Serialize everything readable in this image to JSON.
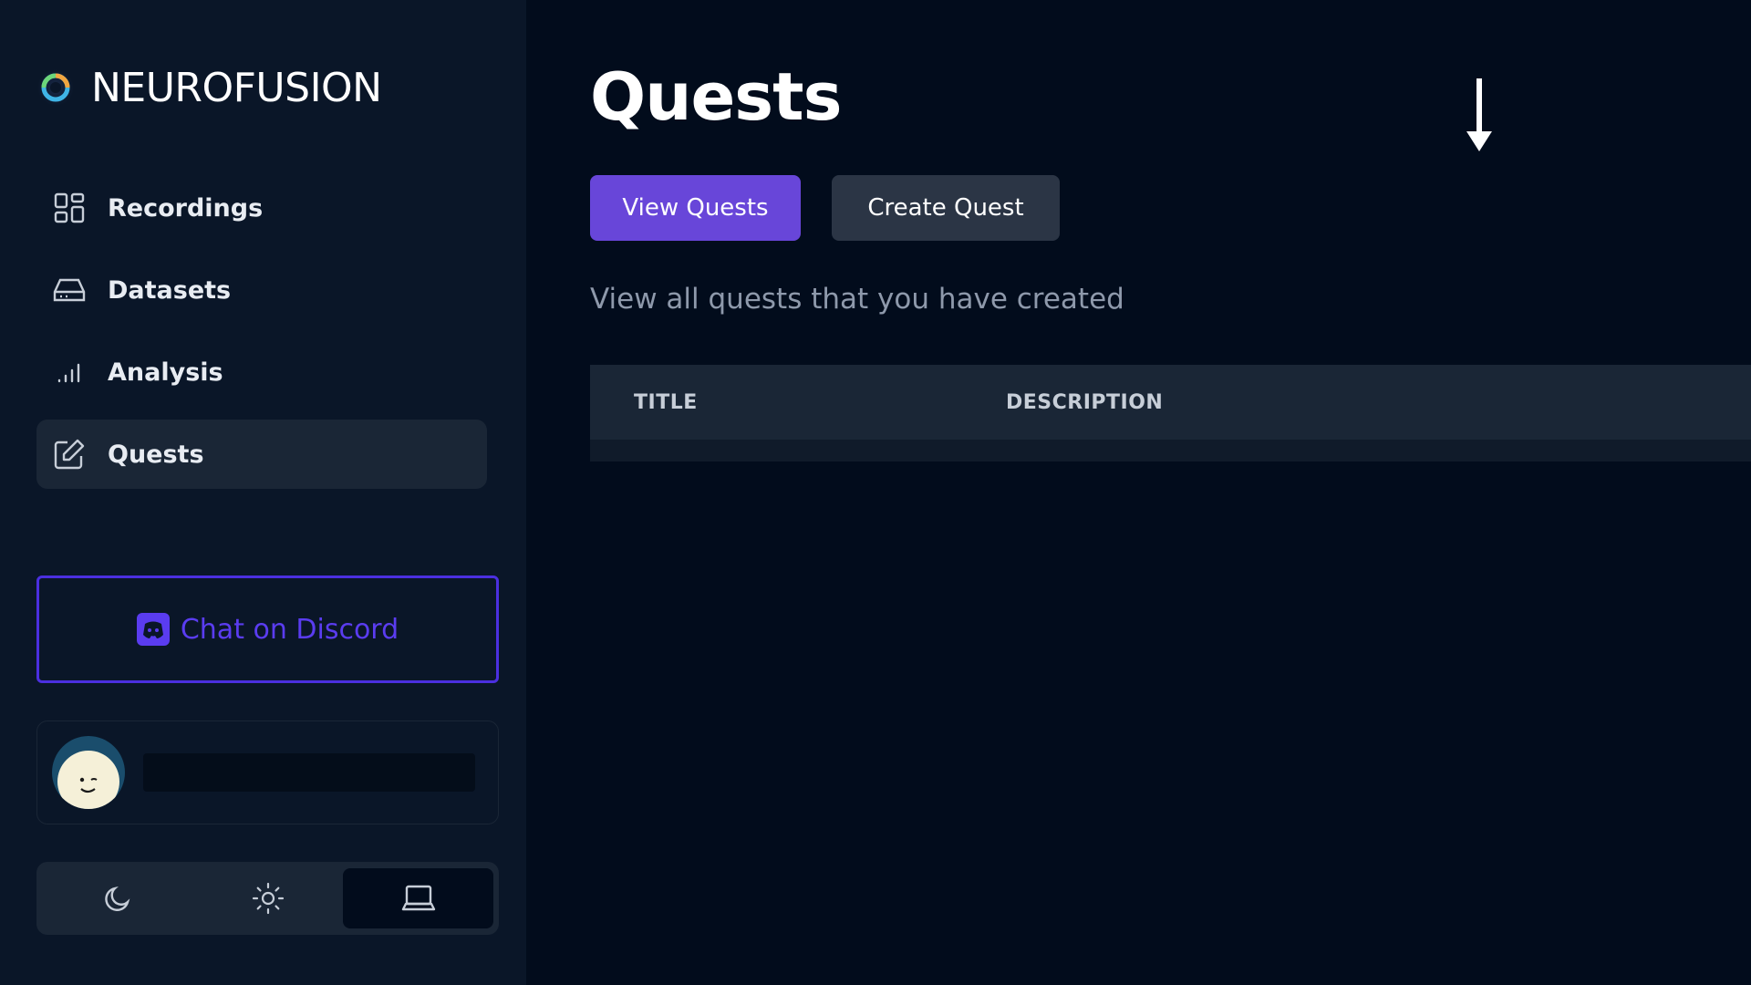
{
  "app": {
    "brand_name": "NEUROFUSION",
    "brand_logo_icon": "neurofusion-logo-icon"
  },
  "sidebar": {
    "items": [
      {
        "label": "Recordings",
        "icon": "grid-icon",
        "active": false
      },
      {
        "label": "Datasets",
        "icon": "hard-drive-icon",
        "active": false
      },
      {
        "label": "Analysis",
        "icon": "signal-bars-icon",
        "active": false
      },
      {
        "label": "Quests",
        "icon": "edit-icon",
        "active": true
      }
    ],
    "discord": {
      "label": "Chat on Discord",
      "icon": "discord-icon",
      "color": "#5a3cf0"
    },
    "theme_switch": {
      "options": [
        {
          "icon": "moon-icon",
          "selected": false
        },
        {
          "icon": "sun-icon",
          "selected": false
        },
        {
          "icon": "laptop-icon",
          "selected": true
        }
      ]
    }
  },
  "main": {
    "title": "Quests",
    "buttons": {
      "view_quests": "View Quests",
      "create_quest": "Create Quest"
    },
    "subtitle": "View all quests that you have created",
    "table": {
      "columns": [
        "TITLE",
        "DESCRIPTION"
      ],
      "rows": []
    }
  },
  "colors": {
    "background": "#020c1c",
    "sidebar": "#0a1628",
    "accent": "#6846d9",
    "discord_border": "#4b2fe0"
  }
}
